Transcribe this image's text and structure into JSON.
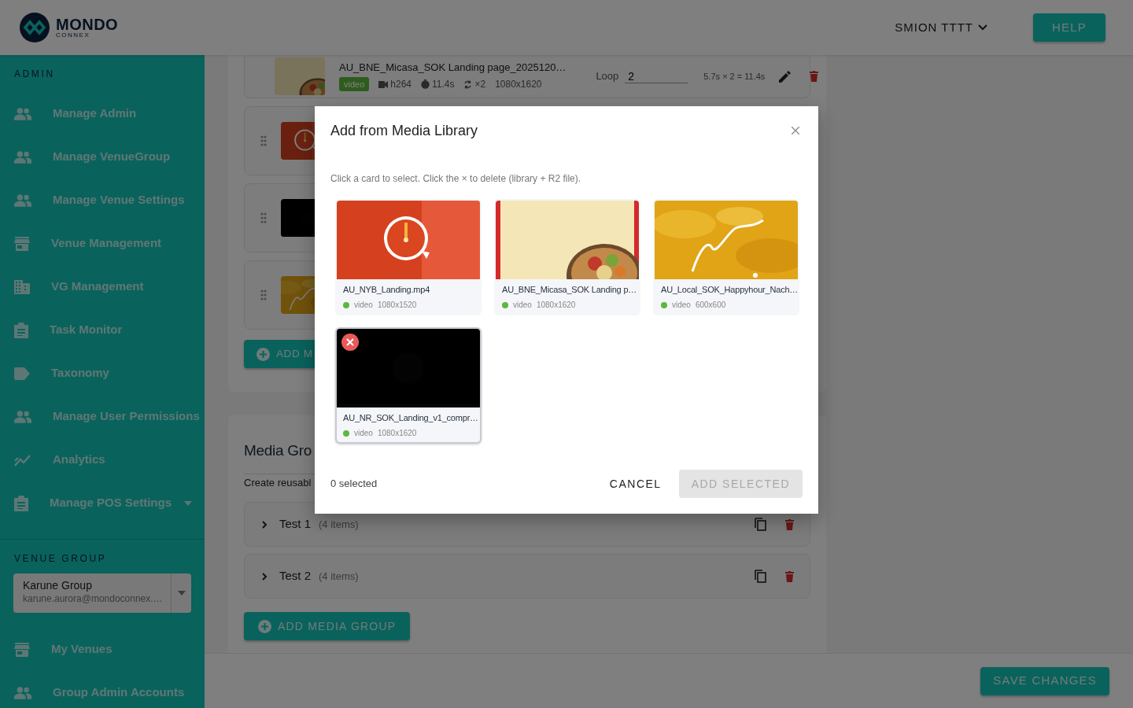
{
  "header": {
    "logo": {
      "name": "MONDO",
      "tagline": "CONNEX"
    },
    "user_menu": "SMION TTTT",
    "help_button": "HELP"
  },
  "sidebar": {
    "admin_title": "ADMIN",
    "admin_items": [
      {
        "label": "Manage Admin",
        "has_submenu": false
      },
      {
        "label": "Manage VenueGroup",
        "has_submenu": false
      },
      {
        "label": "Manage Venue Settings",
        "has_submenu": false
      },
      {
        "label": "Venue Management",
        "has_submenu": false
      },
      {
        "label": "VG Management",
        "has_submenu": false
      },
      {
        "label": "Task Monitor",
        "has_submenu": false
      },
      {
        "label": "Taxonomy",
        "has_submenu": false
      },
      {
        "label": "Manage User Permissions",
        "has_submenu": false
      },
      {
        "label": "Analytics",
        "has_submenu": false
      },
      {
        "label": "Manage POS Settings",
        "has_submenu": true
      }
    ],
    "venue_group_title": "VENUE GROUP",
    "venue_select": {
      "name": "Karune Group",
      "email": "karune.aurora@mondoconnex.…"
    },
    "venue_items": [
      {
        "label": "My Venues",
        "has_submenu": false
      },
      {
        "label": "Group Admin Accounts",
        "has_submenu": false
      }
    ]
  },
  "media_list": {
    "rows": [
      {
        "thumbnail": {
          "kind": "picture"
        },
        "title": "AU_BNE_Micasa_SOK Landing page_2025120…",
        "badge": "video",
        "codec": "h264",
        "duration": "11.4s",
        "loops": "×2",
        "resolution": "1080x1620",
        "loop_label": "Loop",
        "loop_value": "2",
        "total": "5.7s × 2 = 11.4s"
      },
      {
        "thumbnail": {
          "kind": "picture"
        }
      },
      {
        "thumbnail": {
          "kind": "picture"
        }
      },
      {
        "thumbnail": {
          "kind": "picture"
        }
      }
    ],
    "add_button": "ADD M"
  },
  "media_groups": {
    "title": "Media Gro",
    "description": "Create reusabl",
    "groups": [
      {
        "name": "Test 1",
        "count": "(4 items)",
        "expanded": false
      },
      {
        "name": "Test 2",
        "count": "(4 items)",
        "expanded": false
      }
    ],
    "add_button": "ADD MEDIA GROUP"
  },
  "footer": {
    "save_button": "SAVE CHANGES"
  },
  "modal": {
    "title": "Add from Media Library",
    "hint": "Click a card to select. Click the × to delete (library + R2 file).",
    "items": [
      {
        "name": "AU_NYB_Landing.mp4",
        "type": "video",
        "resolution": "1080x1520",
        "selected": false,
        "hovered": false
      },
      {
        "name": "AU_BNE_Micasa_SOK Landing p…",
        "type": "video",
        "resolution": "1080x1620",
        "selected": false,
        "hovered": false
      },
      {
        "name": "AU_Local_SOK_Happyhour_Nach…",
        "type": "video",
        "resolution": "600x600",
        "selected": false,
        "hovered": false
      },
      {
        "name": "AU_NR_SOK_Landing_v1_compr…",
        "type": "video",
        "resolution": "1080x1620",
        "selected": false,
        "hovered": true
      }
    ],
    "selected_count": "0 selected",
    "cancel_button": "CANCEL",
    "add_button": "ADD SELECTED",
    "add_disabled": true
  }
}
